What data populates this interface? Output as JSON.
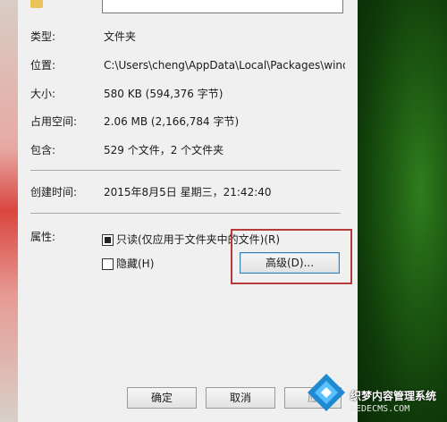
{
  "properties": {
    "type": {
      "label": "类型:",
      "value": "文件夹"
    },
    "location": {
      "label": "位置:",
      "value": "C:\\Users\\cheng\\AppData\\Local\\Packages\\window"
    },
    "size": {
      "label": "大小:",
      "value": "580 KB (594,376 字节)"
    },
    "size_on_disk": {
      "label": "占用空间:",
      "value": "2.06 MB (2,166,784 字节)"
    },
    "contains": {
      "label": "包含:",
      "value": "529 个文件，2 个文件夹"
    },
    "created": {
      "label": "创建时间:",
      "value": "2015年8月5日 星期三，21:42:40"
    },
    "attributes": {
      "label": "属性:",
      "readonly_label": "只读(仅应用于文件夹中的文件)(R)",
      "hidden_label": "隐藏(H)",
      "advanced_button": "高级(D)..."
    }
  },
  "footer": {
    "ok_button": "确定",
    "cancel_button": "取消",
    "apply_button": "应"
  },
  "watermark": {
    "text": "织梦内容管理系统",
    "url": "DEDECMS.COM"
  },
  "colors": {
    "highlight_border": "#b53a3a",
    "dialog_bg": "#f0f0f0"
  }
}
